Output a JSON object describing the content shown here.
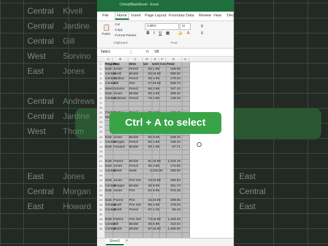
{
  "app": {
    "title": "ChristyBlackNovel - Excel"
  },
  "tabs": [
    "File",
    "Home",
    "Insert",
    "Page Layout",
    "Formulas",
    "Data",
    "Review",
    "View",
    "Dev"
  ],
  "active_tab": "Home",
  "ribbon": {
    "paste_label": "Paste",
    "cut_label": "Cut",
    "copy_label": "Copy",
    "format_painter_label": "Format Painter",
    "clipboard_group": "Clipboard",
    "font_name": "Calibri",
    "font_size": "11",
    "font_group": "Font",
    "bold": "B",
    "italic": "I",
    "underline": "U"
  },
  "formula_bar": {
    "name_box": "Table1",
    "fx": "fx",
    "value": "SB"
  },
  "columns": [
    "A",
    "B",
    "C",
    "D",
    "E",
    "F",
    "G",
    "H"
  ],
  "headers": [
    "Region",
    "Rep",
    "Item",
    "Un",
    "Unit",
    "Cos",
    "Total"
  ],
  "rows": [
    [
      "East",
      "Jones",
      "Pencil",
      "95",
      "1.99",
      "189.05"
    ],
    [
      "Central",
      "Kivell",
      "Binder",
      "50",
      "19.99",
      "999.50"
    ],
    [
      "Central",
      "Jardine",
      "Pencil",
      "36",
      "4.99",
      "179.64"
    ],
    [
      "Central",
      "Gill",
      "Pen",
      "27",
      "19.99",
      "539.73"
    ],
    [
      "West",
      "Sorvino",
      "Pencil",
      "56",
      "2.99",
      "167.44"
    ],
    [
      "East",
      "Jones",
      "Binder",
      "60",
      "4.99",
      "299.40"
    ],
    [
      "Central",
      "Andrews",
      "Pencil",
      "75",
      "1.99",
      "149.25"
    ],
    [
      "",
      "",
      "",
      "",
      "",
      ""
    ],
    [
      "",
      "",
      "",
      "",
      "",
      ""
    ],
    [
      "Central",
      "Jardine",
      "Pencil",
      "90",
      "4.99",
      "449.10"
    ],
    [
      "West",
      "Thompson",
      "Pencil",
      "",
      "",
      ""
    ],
    [
      "",
      "",
      "",
      "",
      "",
      ""
    ],
    [
      "",
      "",
      "",
      "",
      "",
      ""
    ],
    [
      "",
      "",
      "",
      "",
      "",
      ""
    ],
    [
      "East",
      "Jones",
      "Binder",
      "60",
      "8.99",
      "539.40"
    ],
    [
      "Central",
      "Morgan",
      "Pencil",
      "90",
      "4.99",
      "449.10"
    ],
    [
      "East",
      "Howard",
      "Binder",
      "29",
      "1.99",
      "57.71"
    ],
    [
      "",
      "",
      "",
      "",
      "",
      ""
    ],
    [
      "",
      "",
      "",
      "",
      "",
      ""
    ],
    [
      "East",
      "Parent",
      "Binder",
      "81",
      "19.99",
      "1,619.19"
    ],
    [
      "East",
      "Jones",
      "Pencil",
      "35",
      "4.99",
      "174.65"
    ],
    [
      "Central",
      "Smith",
      "Desk",
      "2",
      "125.00",
      "250.00"
    ],
    [
      "",
      "",
      "",
      "",
      "",
      ""
    ],
    [
      "East",
      "Jones",
      "Pen Set",
      "16",
      "15.99",
      "255.84"
    ],
    [
      "Central",
      "Morgan",
      "Binder",
      "28",
      "8.99",
      "251.72"
    ],
    [
      "East",
      "Jones",
      "Pen",
      "64",
      "8.99",
      "575.36"
    ],
    [
      "",
      "",
      "",
      "",
      "",
      ""
    ],
    [
      "East",
      "Parent",
      "Pen",
      "15",
      "19.99",
      "299.85"
    ],
    [
      "Central",
      "Kivell",
      "Pen Set",
      "96",
      "4.99",
      "479.04"
    ],
    [
      "Central",
      "Smith",
      "Pencil",
      "67",
      "1.29",
      "86.43"
    ],
    [
      "",
      "",
      "",
      "",
      "",
      ""
    ],
    [
      "East",
      "Parent",
      "Pen Set",
      "74",
      "15.99",
      "1,183.26"
    ],
    [
      "Central",
      "Gill",
      "Binder",
      "46",
      "8.99",
      "413.54"
    ],
    [
      "Central",
      "Smith",
      "Binder",
      "87",
      "15.00",
      "1,305.00"
    ]
  ],
  "sheet_tab": "Sheet1",
  "add_sheet": "+",
  "overlay_caption": "Ctrl + A to select",
  "background": {
    "regions": [
      "Central",
      "Central",
      "Central",
      "West",
      "East",
      "Central",
      "Central",
      "West",
      "East",
      "Central",
      "East"
    ],
    "reps": [
      "Kivell",
      "Jardine",
      "Gill",
      "Sorvino",
      "Jones",
      "Andrews",
      "Jardine",
      "Thom",
      "Jones",
      "Morgan",
      "Howard"
    ]
  },
  "colors": {
    "excel_green": "#1e6e3e",
    "selection_gray": "#bdbdbd",
    "caption_green": "#39a447"
  }
}
